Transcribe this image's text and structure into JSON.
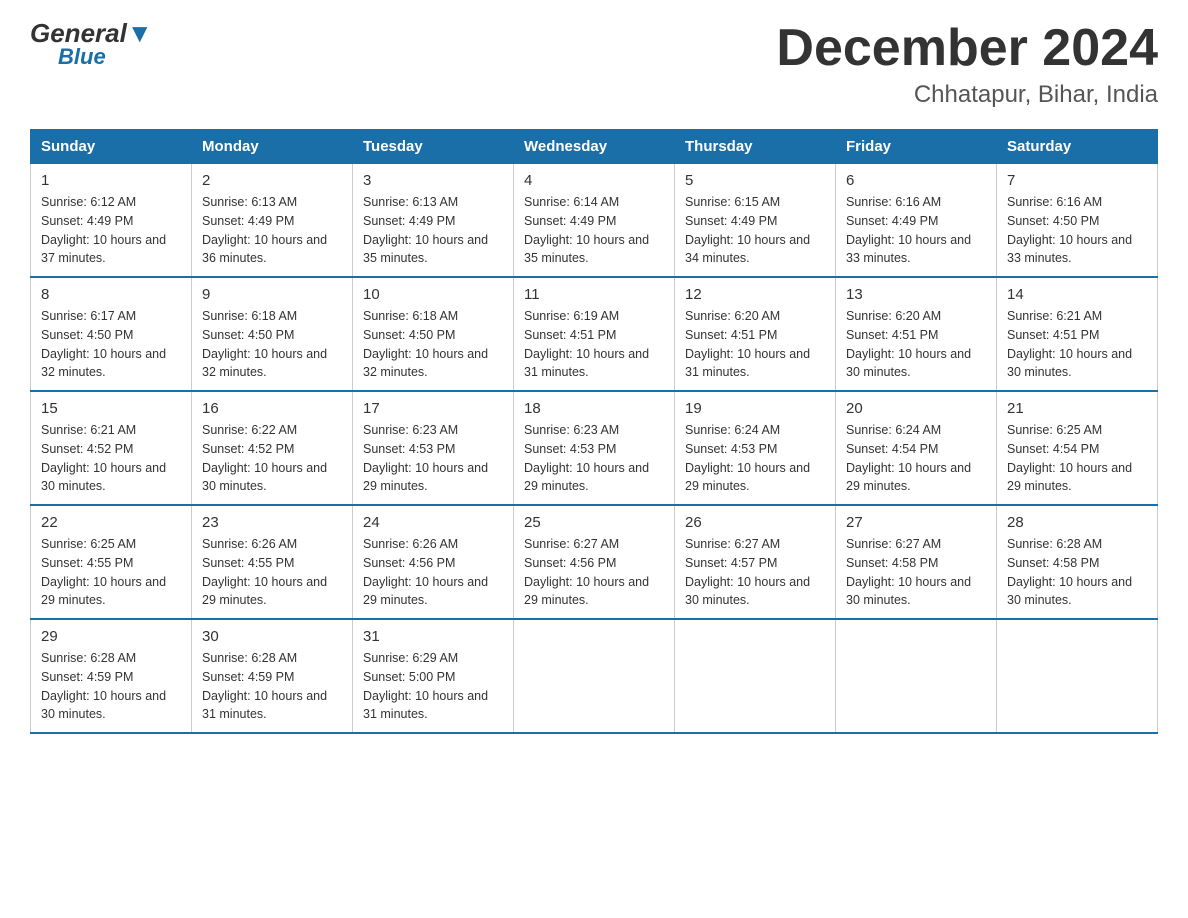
{
  "header": {
    "logo_text1": "General",
    "logo_text2": "Blue",
    "month_year": "December 2024",
    "location": "Chhatapur, Bihar, India"
  },
  "days_of_week": [
    "Sunday",
    "Monday",
    "Tuesday",
    "Wednesday",
    "Thursday",
    "Friday",
    "Saturday"
  ],
  "weeks": [
    [
      {
        "day": "1",
        "sunrise": "6:12 AM",
        "sunset": "4:49 PM",
        "daylight": "10 hours and 37 minutes."
      },
      {
        "day": "2",
        "sunrise": "6:13 AM",
        "sunset": "4:49 PM",
        "daylight": "10 hours and 36 minutes."
      },
      {
        "day": "3",
        "sunrise": "6:13 AM",
        "sunset": "4:49 PM",
        "daylight": "10 hours and 35 minutes."
      },
      {
        "day": "4",
        "sunrise": "6:14 AM",
        "sunset": "4:49 PM",
        "daylight": "10 hours and 35 minutes."
      },
      {
        "day": "5",
        "sunrise": "6:15 AM",
        "sunset": "4:49 PM",
        "daylight": "10 hours and 34 minutes."
      },
      {
        "day": "6",
        "sunrise": "6:16 AM",
        "sunset": "4:49 PM",
        "daylight": "10 hours and 33 minutes."
      },
      {
        "day": "7",
        "sunrise": "6:16 AM",
        "sunset": "4:50 PM",
        "daylight": "10 hours and 33 minutes."
      }
    ],
    [
      {
        "day": "8",
        "sunrise": "6:17 AM",
        "sunset": "4:50 PM",
        "daylight": "10 hours and 32 minutes."
      },
      {
        "day": "9",
        "sunrise": "6:18 AM",
        "sunset": "4:50 PM",
        "daylight": "10 hours and 32 minutes."
      },
      {
        "day": "10",
        "sunrise": "6:18 AM",
        "sunset": "4:50 PM",
        "daylight": "10 hours and 32 minutes."
      },
      {
        "day": "11",
        "sunrise": "6:19 AM",
        "sunset": "4:51 PM",
        "daylight": "10 hours and 31 minutes."
      },
      {
        "day": "12",
        "sunrise": "6:20 AM",
        "sunset": "4:51 PM",
        "daylight": "10 hours and 31 minutes."
      },
      {
        "day": "13",
        "sunrise": "6:20 AM",
        "sunset": "4:51 PM",
        "daylight": "10 hours and 30 minutes."
      },
      {
        "day": "14",
        "sunrise": "6:21 AM",
        "sunset": "4:51 PM",
        "daylight": "10 hours and 30 minutes."
      }
    ],
    [
      {
        "day": "15",
        "sunrise": "6:21 AM",
        "sunset": "4:52 PM",
        "daylight": "10 hours and 30 minutes."
      },
      {
        "day": "16",
        "sunrise": "6:22 AM",
        "sunset": "4:52 PM",
        "daylight": "10 hours and 30 minutes."
      },
      {
        "day": "17",
        "sunrise": "6:23 AM",
        "sunset": "4:53 PM",
        "daylight": "10 hours and 29 minutes."
      },
      {
        "day": "18",
        "sunrise": "6:23 AM",
        "sunset": "4:53 PM",
        "daylight": "10 hours and 29 minutes."
      },
      {
        "day": "19",
        "sunrise": "6:24 AM",
        "sunset": "4:53 PM",
        "daylight": "10 hours and 29 minutes."
      },
      {
        "day": "20",
        "sunrise": "6:24 AM",
        "sunset": "4:54 PM",
        "daylight": "10 hours and 29 minutes."
      },
      {
        "day": "21",
        "sunrise": "6:25 AM",
        "sunset": "4:54 PM",
        "daylight": "10 hours and 29 minutes."
      }
    ],
    [
      {
        "day": "22",
        "sunrise": "6:25 AM",
        "sunset": "4:55 PM",
        "daylight": "10 hours and 29 minutes."
      },
      {
        "day": "23",
        "sunrise": "6:26 AM",
        "sunset": "4:55 PM",
        "daylight": "10 hours and 29 minutes."
      },
      {
        "day": "24",
        "sunrise": "6:26 AM",
        "sunset": "4:56 PM",
        "daylight": "10 hours and 29 minutes."
      },
      {
        "day": "25",
        "sunrise": "6:27 AM",
        "sunset": "4:56 PM",
        "daylight": "10 hours and 29 minutes."
      },
      {
        "day": "26",
        "sunrise": "6:27 AM",
        "sunset": "4:57 PM",
        "daylight": "10 hours and 30 minutes."
      },
      {
        "day": "27",
        "sunrise": "6:27 AM",
        "sunset": "4:58 PM",
        "daylight": "10 hours and 30 minutes."
      },
      {
        "day": "28",
        "sunrise": "6:28 AM",
        "sunset": "4:58 PM",
        "daylight": "10 hours and 30 minutes."
      }
    ],
    [
      {
        "day": "29",
        "sunrise": "6:28 AM",
        "sunset": "4:59 PM",
        "daylight": "10 hours and 30 minutes."
      },
      {
        "day": "30",
        "sunrise": "6:28 AM",
        "sunset": "4:59 PM",
        "daylight": "10 hours and 31 minutes."
      },
      {
        "day": "31",
        "sunrise": "6:29 AM",
        "sunset": "5:00 PM",
        "daylight": "10 hours and 31 minutes."
      },
      null,
      null,
      null,
      null
    ]
  ]
}
